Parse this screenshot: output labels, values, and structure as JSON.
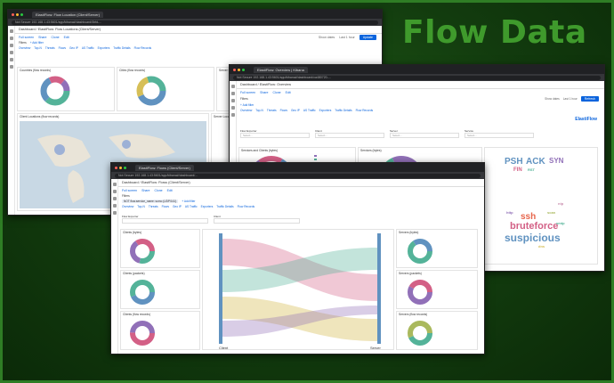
{
  "heading": "Flow Data",
  "colors": {
    "accent": "#3f9a2c",
    "border": "#2f7d25",
    "kibana_blue": "#0b64dd"
  },
  "win1": {
    "tab": "ElastiFlow: Flow Location (Client/Server)",
    "url": "Not Secure  192.168.1.43:5601/app/kibana#/dashboard/0bfd-...",
    "kibana_title": "Dashboard / ElastiFlow: Flow Locations (Client/Server)",
    "menu": [
      "Full screen",
      "Share",
      "Clone",
      "Edit"
    ],
    "filter_label": "Filters",
    "add_filter": "+ Add filter",
    "nav_links": [
      "Overview",
      "Top-N",
      "Threats",
      "Flows",
      "Geo IP",
      "AS Traffic",
      "Exporters",
      "Traffic Details",
      "Flow Records"
    ],
    "panels": [
      "Countries (flow records)",
      "Cities (flow records)",
      "Server Locations (flow records)",
      "Client Locations (flow records)",
      "Server Locations (flow records)"
    ],
    "update": "Update",
    "time": "Last 1 hour",
    "show_dates": "Show dates"
  },
  "win2": {
    "tab": "ElastiFlow: Overview | Kibana",
    "url": "Not Secure  192.168.1.43:5601/app/kibana#/dashboard/ca480720-...",
    "kibana_title": "Dashboard / ElastiFlow: Overview",
    "menu": [
      "Full screen",
      "Share",
      "Clone",
      "Edit"
    ],
    "filter_label": "Filters",
    "add_filter": "+ Add filter",
    "nav_links": [
      "Overview",
      "Top-N",
      "Threats",
      "Flows",
      "Geo IP",
      "AS Traffic",
      "Exporters",
      "Traffic Details",
      "Flow Records"
    ],
    "selects": [
      "Flow Exporter",
      "Client",
      "Server",
      "Service"
    ],
    "select_placeholder": "Select...",
    "panels": [
      "Services and Clients (bytes)",
      "Services (bytes)",
      "Autonomous Systems (bytes)",
      "IP Versions and Protocols (bytes)"
    ],
    "logo": "ElastiFlow",
    "refresh": "Refresh",
    "time": "Last 1 hour",
    "show_dates": "Show dates",
    "words": [
      "PSH",
      "ACK",
      "SYN",
      "FIN",
      "RST",
      "ssh",
      "bruteforce",
      "suspicious",
      "scan",
      "http",
      "smtp",
      "dns",
      "ntp"
    ]
  },
  "win3": {
    "tab": "ElastiFlow: Flows (Client/Server)",
    "url": "Not Secure  192.168.1.43:5601/app/kibana#/dashboard/...",
    "kibana_title": "Dashboard / ElastiFlow: Flows (Client/Server)",
    "menu": [
      "Full screen",
      "Share",
      "Clone",
      "Edit"
    ],
    "filter_label": "Filters",
    "filter_chip": "NOT flow.service_name: sumo (UDP/161)",
    "add_filter": "+ Add filter",
    "nav_links": [
      "Overview",
      "Top-N",
      "Threats",
      "Flows",
      "Geo IP",
      "AS Traffic",
      "Exporters",
      "Traffic Details",
      "Flow Records"
    ],
    "selects": [
      "Flow Exporter",
      "Client"
    ],
    "panels": [
      "Clients (bytes)",
      "Clients (packets)",
      "Clients (flow records)",
      "Servers (bytes)",
      "Servers (packets)",
      "Servers (flow records)"
    ],
    "axis_client": "Client",
    "axis_server": "Server"
  }
}
